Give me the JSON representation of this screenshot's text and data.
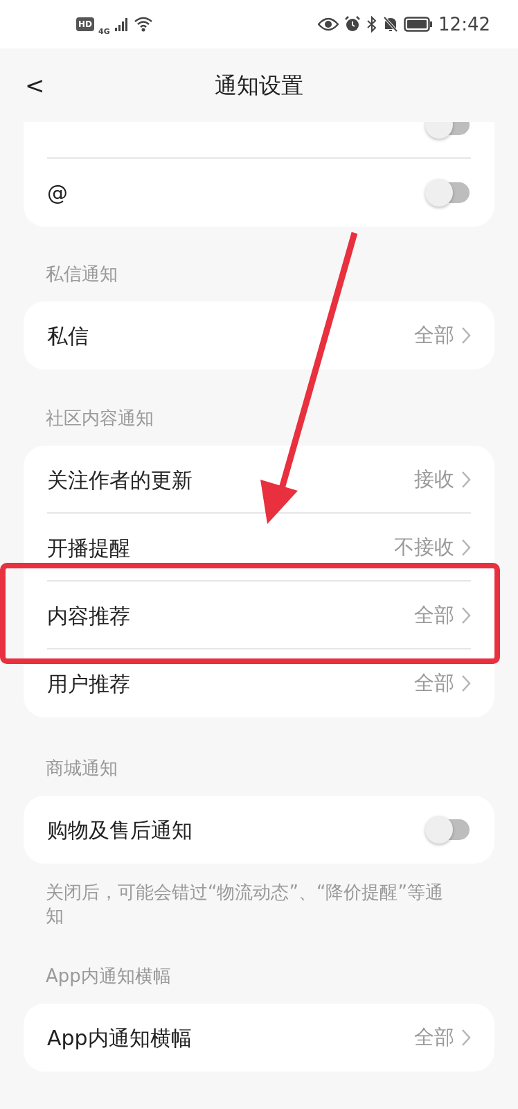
{
  "status_bar": {
    "hd": "HD",
    "network": "4G",
    "time": "12:42"
  },
  "header": {
    "back": "<",
    "title": "通知设置"
  },
  "sections": [
    {
      "rows": [
        {
          "kind": "toggle",
          "on": false
        },
        {
          "label": "@",
          "kind": "toggle",
          "on": false
        }
      ]
    },
    {
      "title": "私信通知",
      "rows": [
        {
          "label": "私信",
          "kind": "value",
          "value": "全部"
        }
      ]
    },
    {
      "title": "社区内容通知",
      "rows": [
        {
          "label": "关注作者的更新",
          "kind": "value",
          "value": "接收"
        },
        {
          "label": "开播提醒",
          "kind": "value",
          "value": "不接收"
        },
        {
          "label": "内容推荐",
          "kind": "value",
          "value": "全部"
        },
        {
          "label": "用户推荐",
          "kind": "value",
          "value": "全部"
        }
      ]
    },
    {
      "title": "商城通知",
      "rows": [
        {
          "label": "购物及售后通知",
          "kind": "toggle",
          "on": false
        }
      ],
      "note": "关闭后，可能会错过“物流动态”、“降价提醒”等通知"
    },
    {
      "title": "App内通知横幅",
      "rows": [
        {
          "label": "App内通知横幅",
          "kind": "value",
          "value": "全部"
        }
      ]
    }
  ]
}
